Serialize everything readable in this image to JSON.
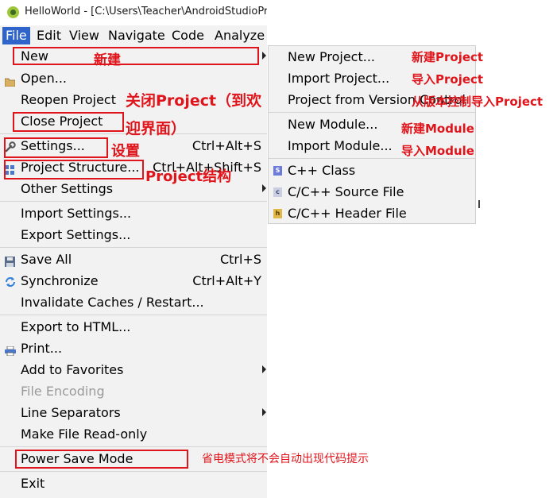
{
  "window": {
    "title": "HelloWorld - [C:\\Users\\Teacher\\AndroidStudioProjec"
  },
  "menubar": [
    "File",
    "Edit",
    "View",
    "Navigate",
    "Code",
    "Analyze"
  ],
  "file_menu": {
    "new": "New",
    "open": "Open...",
    "reopen_project": "Reopen Project",
    "close_project": "Close Project",
    "settings": "Settings...",
    "settings_shortcut": "Ctrl+Alt+S",
    "project_structure": "Project Structure...",
    "project_structure_shortcut": "Ctrl+Alt+Shift+S",
    "other_settings": "Other Settings",
    "import_settings": "Import Settings...",
    "export_settings": "Export Settings...",
    "save_all": "Save All",
    "save_all_shortcut": "Ctrl+S",
    "synchronize": "Synchronize",
    "synchronize_shortcut": "Ctrl+Alt+Y",
    "invalidate_caches": "Invalidate Caches / Restart...",
    "export_html": "Export to HTML...",
    "print": "Print...",
    "add_favorites": "Add to Favorites",
    "file_encoding": "File Encoding",
    "line_separators": "Line Separators",
    "make_read_only": "Make File Read-only",
    "power_save": "Power Save Mode",
    "exit": "Exit"
  },
  "new_submenu": {
    "new_project": "New Project...",
    "import_project": "Import Project...",
    "project_from_vcs": "Project from Version Control",
    "new_module": "New Module...",
    "import_module": "Import Module...",
    "cpp_class": "C++ Class",
    "cpp_source": "C/C++ Source File",
    "cpp_header": "C/C++ Header File"
  },
  "annotations": {
    "new": "新建",
    "close_project_1": "关闭Project（到欢",
    "close_project_2": "迎界面）",
    "settings": "设置",
    "project_structure": "Project结构",
    "new_project": "新建Project",
    "import_project": "导入Project",
    "project_from_vcs": "从版本控制导入Project",
    "new_module": "新建Module",
    "import_module": "导入Module",
    "power_save": "省电模式将不会自动出现代码提示"
  },
  "colors": {
    "annotation_red": "#e0141b",
    "menu_bg": "#f2f2f2",
    "active_menu": "#2f65ca"
  }
}
